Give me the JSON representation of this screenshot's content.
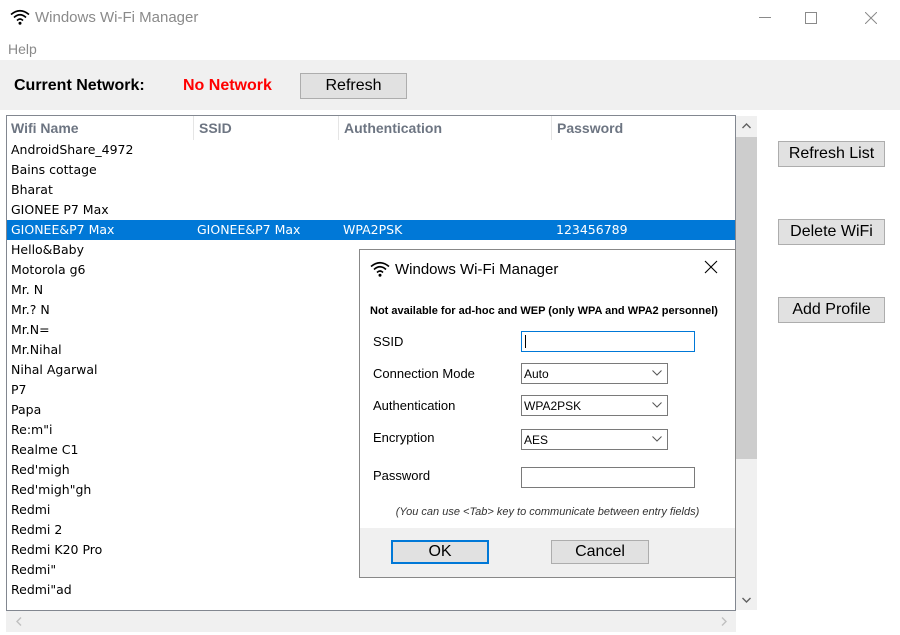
{
  "window": {
    "title": "Windows Wi-Fi Manager",
    "icons": {
      "app": "wifi-icon",
      "minimize": "minimize-icon",
      "maximize": "maximize-icon",
      "close": "close-icon"
    }
  },
  "menu": {
    "items": [
      {
        "label": "Help"
      }
    ]
  },
  "status": {
    "current_label": "Current Network:",
    "current_value": "No Network",
    "current_value_color": "#ff0000",
    "refresh_label": "Refresh"
  },
  "list": {
    "columns": [
      "Wifi Name",
      "SSID",
      "Authentication",
      "Password"
    ],
    "selection_color": "#0078d7",
    "rows": [
      {
        "name": "AndroidShare_4972",
        "ssid": "",
        "auth": "",
        "password": ""
      },
      {
        "name": "Bains cottage",
        "ssid": "",
        "auth": "",
        "password": ""
      },
      {
        "name": "Bharat",
        "ssid": "",
        "auth": "",
        "password": ""
      },
      {
        "name": "GIONEE P7 Max",
        "ssid": "",
        "auth": "",
        "password": ""
      },
      {
        "name": "GIONEE&P7 Max",
        "ssid": "GIONEE&P7 Max",
        "auth": "WPA2PSK",
        "password": "123456789",
        "selected": true
      },
      {
        "name": "Hello&Baby",
        "ssid": "",
        "auth": "",
        "password": ""
      },
      {
        "name": "Motorola g6",
        "ssid": "",
        "auth": "",
        "password": ""
      },
      {
        "name": "Mr. N",
        "ssid": "",
        "auth": "",
        "password": ""
      },
      {
        "name": "Mr.? N",
        "ssid": "",
        "auth": "",
        "password": ""
      },
      {
        "name": "Mr.N=",
        "ssid": "",
        "auth": "",
        "password": ""
      },
      {
        "name": "Mr.Nihal",
        "ssid": "",
        "auth": "",
        "password": ""
      },
      {
        "name": "Nihal Agarwal",
        "ssid": "",
        "auth": "",
        "password": ""
      },
      {
        "name": "P7",
        "ssid": "",
        "auth": "",
        "password": ""
      },
      {
        "name": "Papa",
        "ssid": "",
        "auth": "",
        "password": ""
      },
      {
        "name": "Re:m\"i",
        "ssid": "",
        "auth": "",
        "password": ""
      },
      {
        "name": "Realme C1",
        "ssid": "",
        "auth": "",
        "password": ""
      },
      {
        "name": "Red'migh",
        "ssid": "",
        "auth": "",
        "password": ""
      },
      {
        "name": "Red'migh\"gh",
        "ssid": "",
        "auth": "",
        "password": ""
      },
      {
        "name": "Redmi",
        "ssid": "",
        "auth": "",
        "password": ""
      },
      {
        "name": "Redmi 2",
        "ssid": "",
        "auth": "",
        "password": ""
      },
      {
        "name": "Redmi K20 Pro",
        "ssid": "",
        "auth": "",
        "password": ""
      },
      {
        "name": "Redmi\"",
        "ssid": "",
        "auth": "",
        "password": ""
      },
      {
        "name": "Redmi\"ad",
        "ssid": "",
        "auth": "",
        "password": ""
      }
    ]
  },
  "side_buttons": {
    "refresh_list": "Refresh List",
    "delete_wifi": "Delete WiFi",
    "add_profile": "Add Profile"
  },
  "dialog": {
    "title": "Windows Wi-Fi Manager",
    "note": "Not available for ad-hoc and WEP (only WPA and WPA2 personnel)",
    "fields": {
      "ssid": {
        "label": "SSID",
        "value": ""
      },
      "connection_mode": {
        "label": "Connection Mode",
        "value": "Auto"
      },
      "authentication": {
        "label": "Authentication",
        "value": "WPA2PSK"
      },
      "encryption": {
        "label": "Encryption",
        "value": "AES"
      },
      "password": {
        "label": "Password",
        "value": ""
      }
    },
    "hint": "(You can use <Tab> key to communicate between entry fields)",
    "ok_label": "OK",
    "cancel_label": "Cancel"
  }
}
